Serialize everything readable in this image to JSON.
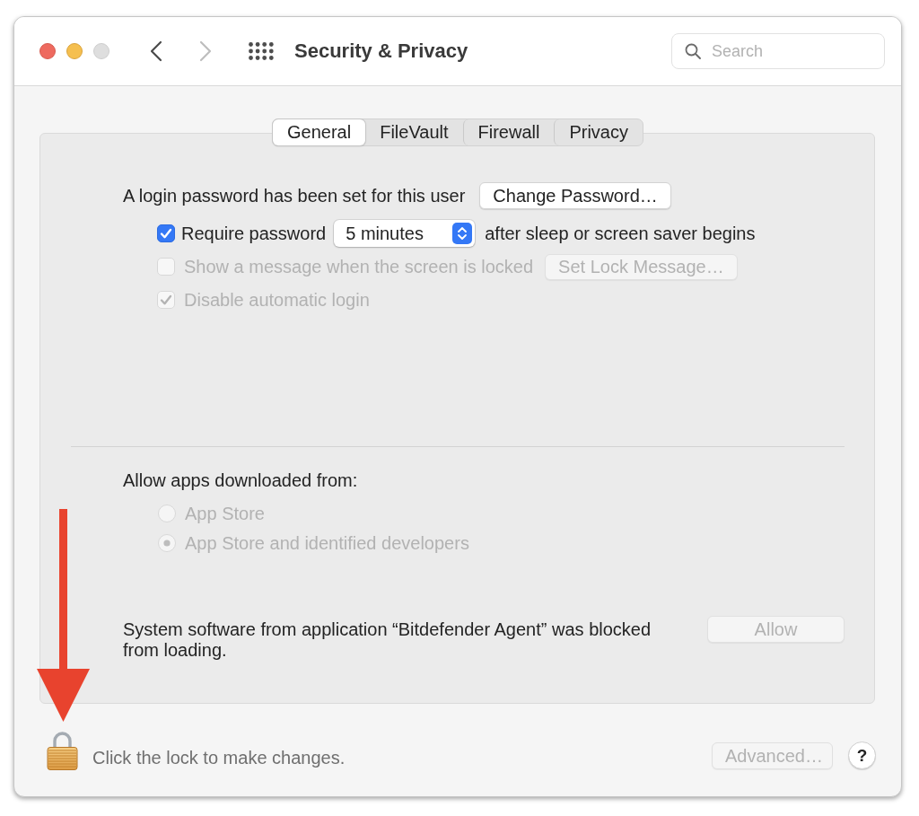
{
  "window": {
    "title": "Security & Privacy",
    "controls": [
      {
        "kind": "close",
        "disabled": false
      },
      {
        "kind": "minimize",
        "disabled": false
      },
      {
        "kind": "zoom",
        "disabled": true
      }
    ]
  },
  "navigation": [
    {
      "kind": "back",
      "disabled": false
    },
    {
      "kind": "forward",
      "disabled": true
    }
  ],
  "search": {
    "placeholder": "Search"
  },
  "tabs": [
    {
      "label": "General",
      "selected": true
    },
    {
      "label": "FileVault",
      "selected": false
    },
    {
      "label": "Firewall",
      "selected": false
    },
    {
      "label": "Privacy",
      "selected": false
    }
  ],
  "general": {
    "password_notice": "A login password has been set for this user",
    "change_password_button": {
      "label": "Change Password…",
      "disabled": false
    },
    "options": [
      {
        "label": "Require password",
        "checked": true,
        "disabled": false,
        "delay_select": {
          "value": "5 minutes"
        },
        "trailing_text": "after sleep or screen saver begins"
      },
      {
        "label": "Show a message when the screen is locked",
        "checked": false,
        "disabled": true,
        "button": {
          "label": "Set Lock Message…",
          "disabled": true
        }
      },
      {
        "label": "Disable automatic login",
        "checked": true,
        "disabled": true
      }
    ],
    "downloads": {
      "heading": "Allow apps downloaded from:",
      "options": [
        {
          "label": "App Store",
          "selected": false,
          "disabled": true
        },
        {
          "label": "App Store and identified developers",
          "selected": true,
          "disabled": true
        }
      ]
    },
    "blocked_notice": {
      "text": "System software from application “Bitdefender Agent” was blocked from loading.",
      "button": {
        "label": "Allow",
        "disabled": true
      }
    }
  },
  "footer": {
    "locked": true,
    "lock_text": "Click the lock to make changes.",
    "advanced_button": {
      "label": "Advanced…",
      "disabled": true
    },
    "help_button": {
      "label": "?"
    }
  },
  "annotations": [
    {
      "kind": "arrow"
    }
  ]
}
